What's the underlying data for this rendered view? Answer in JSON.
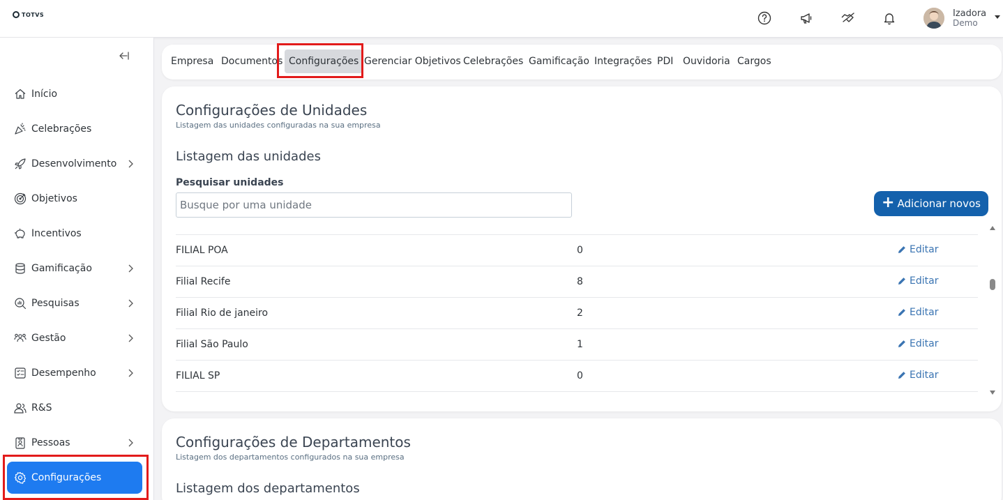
{
  "header": {
    "logo_text": "TOTVS",
    "icons": [
      "help-icon",
      "megaphone-icon",
      "handshake-icon",
      "bell-icon"
    ],
    "user": {
      "name": "Izadora",
      "role": "Demo"
    }
  },
  "sidebar": {
    "items": [
      {
        "label": "Início",
        "icon": "home-icon",
        "has_children": false
      },
      {
        "label": "Celebrações",
        "icon": "party-icon",
        "has_children": false
      },
      {
        "label": "Desenvolvimento",
        "icon": "rocket-icon",
        "has_children": true
      },
      {
        "label": "Objetivos",
        "icon": "target-icon",
        "has_children": false
      },
      {
        "label": "Incentivos",
        "icon": "piggy-bank-icon",
        "has_children": false
      },
      {
        "label": "Gamificação",
        "icon": "coins-icon",
        "has_children": true
      },
      {
        "label": "Pesquisas",
        "icon": "search-chart-icon",
        "has_children": true
      },
      {
        "label": "Gestão",
        "icon": "team-icon",
        "has_children": true
      },
      {
        "label": "Desempenho",
        "icon": "checklist-icon",
        "has_children": true
      },
      {
        "label": "R&S",
        "icon": "people-icon",
        "has_children": false
      },
      {
        "label": "Pessoas",
        "icon": "badge-icon",
        "has_children": true
      },
      {
        "label": "Configurações",
        "icon": "gear-icon",
        "has_children": false,
        "active": true
      }
    ]
  },
  "tabs": [
    {
      "label": "Empresa"
    },
    {
      "label": "Documentos"
    },
    {
      "label": "Configurações",
      "active": true
    },
    {
      "label": "Gerenciar Objetivos"
    },
    {
      "label": "Celebrações"
    },
    {
      "label": "Gamificação"
    },
    {
      "label": "Integrações"
    },
    {
      "label": "PDI"
    },
    {
      "label": "Ouvidoria"
    },
    {
      "label": "Cargos"
    }
  ],
  "units": {
    "title": "Configurações de Unidades",
    "subtitle": "Listagem das unidades configuradas na sua empresa",
    "list_title": "Listagem das unidades",
    "search_label": "Pesquisar unidades",
    "search_placeholder": "Busque por uma unidade",
    "add_button": "Adicionar novos",
    "add_symbol": "+",
    "edit_label": "Editar",
    "rows": [
      {
        "name": "FILIAL POA",
        "count": "0"
      },
      {
        "name": "Filial Recife",
        "count": "8"
      },
      {
        "name": "Filial Rio de janeiro",
        "count": "2"
      },
      {
        "name": "Filial São Paulo",
        "count": "1"
      },
      {
        "name": "FILIAL SP",
        "count": "0"
      }
    ]
  },
  "departments": {
    "title": "Configurações de Departamentos",
    "subtitle": "Listagem dos departamentos configurados na sua empresa",
    "list_title": "Listagem dos departamentos"
  },
  "colors": {
    "accent": "#1e7bf0",
    "button": "#1461ac",
    "link": "#3a74b2",
    "highlight": "#e21b1b"
  }
}
